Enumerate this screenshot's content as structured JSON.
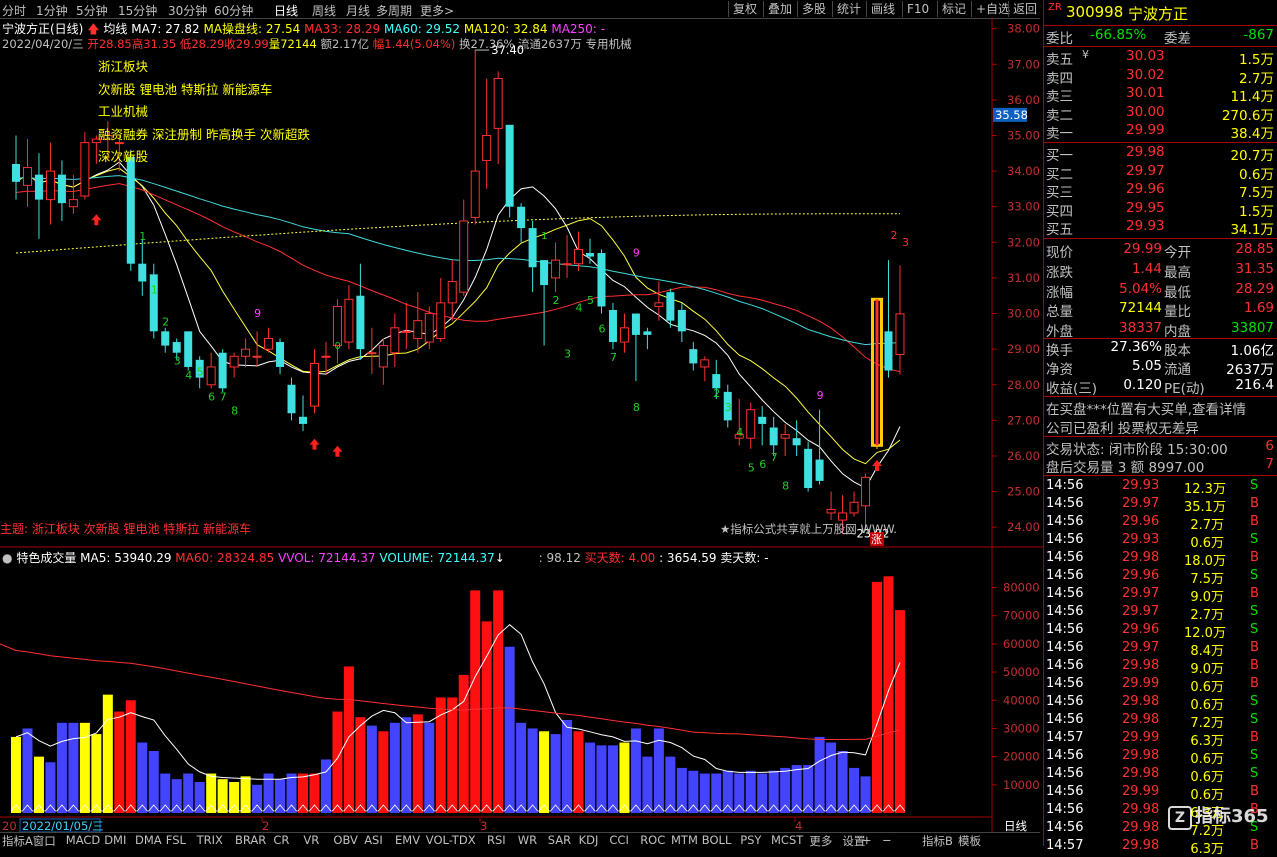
{
  "topbar": {
    "periods": [
      "分时",
      "1分钟",
      "5分钟",
      "15分钟",
      "30分钟",
      "60分钟",
      "日线",
      "周线",
      "月线",
      "多周期",
      "更多>"
    ],
    "active_period": "日线",
    "right_buttons": [
      "复权",
      "叠加",
      "多股",
      "统计",
      "画线",
      "F10",
      "标记",
      "+自选",
      "返回"
    ]
  },
  "ma_line": {
    "stock": "宁波方正(日线)",
    "indicator": "均线",
    "ma7": "MA7: 27.82",
    "ma_cp": "MA操盘线: 27.54",
    "ma33": "MA33: 28.29",
    "ma60": "MA60: 29.52",
    "ma120": "MA120: 32.84",
    "ma250": "MA250: -"
  },
  "bar_info": {
    "date": "2022/04/20/三",
    "open": "开28.85",
    "high": "高31.35",
    "low": "低28.29",
    "close": "收29.99",
    "vol": "量72144",
    "amount": "额2.17亿",
    "change": "幅1.44(5.04%)",
    "turnover": "换27.36%",
    "float": "流通2637万",
    "industry": "专用机械"
  },
  "tags": [
    "浙江板块",
    "次新股 锂电池 特斯拉 新能源车",
    "工业机械",
    "融资融券 深注册制 昨高换手 次新超跌",
    "深次新股"
  ],
  "bottom_tag": "主题: 浙江板块 次新股 锂电池 特斯拉 新能源车",
  "watermark": "★指标公式共享就上万股网 WWW.",
  "price_axis": [
    "38.00",
    "37.00",
    "36.00",
    "35.00",
    "34.00",
    "33.00",
    "32.00",
    "31.00",
    "30.00",
    "29.00",
    "28.00",
    "27.00",
    "26.00",
    "25.00",
    "24.00"
  ],
  "price_marker": "35.58",
  "high_mark": "37.40",
  "low_mark": "23.82",
  "zhang_label": "涨",
  "volume_panel": {
    "title": "特色成交量",
    "ma5": "MA5: 53940.29",
    "ma60": "MA60: 28324.85",
    "vvol": "VVOL: 72144.37",
    "volume": "VOLUME: 72144.37",
    "v1": ": 98.12",
    "buy_days": "买天数: 4.00",
    "v2": ": 3654.59",
    "sell_days": "卖天数: -",
    "axis": [
      "80000",
      "70000",
      "60000",
      "50000",
      "40000",
      "30000",
      "20000",
      "10000"
    ]
  },
  "date_axis": {
    "start": "2022/01/05/三",
    "marks": [
      "2",
      "3",
      "4"
    ],
    "period": "日线"
  },
  "bottom_tabs": [
    "指标A",
    "窗口",
    "MACD",
    "DMI",
    "DMA",
    "FSL",
    "TRIX",
    "BRAR",
    "CR",
    "VR",
    "OBV",
    "ASI",
    "EMV",
    "VOL-TDX",
    "RSI",
    "WR",
    "SAR",
    "KDJ",
    "CCI",
    "ROC",
    "MTM",
    "BOLL",
    "PSY",
    "MCST",
    "更多",
    "设置"
  ],
  "bottom_right_tabs": [
    "指标B",
    "模板"
  ],
  "side": {
    "zr": "ZR",
    "code": "300998",
    "name": "宁波方正",
    "weibi_label": "委比",
    "weibi": "-66.85%",
    "weicha_label": "委差",
    "weicha": "-867",
    "asks": [
      {
        "label": "卖五",
        "price": "30.03",
        "vol": "1.5万"
      },
      {
        "label": "卖四",
        "price": "30.02",
        "vol": "2.7万"
      },
      {
        "label": "卖三",
        "price": "30.01",
        "vol": "11.4万"
      },
      {
        "label": "卖二",
        "price": "30.00",
        "vol": "270.6万"
      },
      {
        "label": "卖一",
        "price": "29.99",
        "vol": "38.4万"
      }
    ],
    "yen": "¥",
    "bids": [
      {
        "label": "买一",
        "price": "29.98",
        "vol": "20.7万"
      },
      {
        "label": "买二",
        "price": "29.97",
        "vol": "0.6万"
      },
      {
        "label": "买三",
        "price": "29.96",
        "vol": "7.5万"
      },
      {
        "label": "买四",
        "price": "29.95",
        "vol": "1.5万"
      },
      {
        "label": "买五",
        "price": "29.93",
        "vol": "34.1万"
      }
    ],
    "stats": [
      {
        "l1": "现价",
        "v1": "29.99",
        "l2": "今开",
        "v2": "28.85"
      },
      {
        "l1": "涨跌",
        "v1": "1.44",
        "l2": "最高",
        "v2": "31.35"
      },
      {
        "l1": "涨幅",
        "v1": "5.04%",
        "l2": "最低",
        "v2": "28.29"
      },
      {
        "l1": "总量",
        "v1": "72144",
        "l2": "量比",
        "v2": "1.69"
      },
      {
        "l1": "外盘",
        "v1": "38337",
        "l2": "内盘",
        "v2": "33807"
      }
    ],
    "stats2": [
      {
        "l1": "换手",
        "v1": "27.36%",
        "l2": "股本",
        "v2": "1.06亿"
      },
      {
        "l1": "净资",
        "v1": "5.05",
        "l2": "流通",
        "v2": "2637万"
      },
      {
        "l1": "收益(三)",
        "v1": "0.120",
        "l2": "PE(动)",
        "v2": "216.4"
      }
    ],
    "notice1": "在买盘***位置有大买单,查看详情",
    "notice2": "公司已盈利 投票权无差异",
    "status_label": "交易状态: 闭市阶段 15:30:00",
    "status_num": "6",
    "after_label": "盘后交易量 3 额 8997.00",
    "after_num": "7",
    "trades": [
      {
        "t": "14:56",
        "p": "29.93",
        "v": "12.3万",
        "s": "S"
      },
      {
        "t": "14:56",
        "p": "29.97",
        "v": "35.1万",
        "s": "B"
      },
      {
        "t": "14:56",
        "p": "29.96",
        "v": "2.7万",
        "s": "B"
      },
      {
        "t": "14:56",
        "p": "29.93",
        "v": "0.6万",
        "s": "S"
      },
      {
        "t": "14:56",
        "p": "29.98",
        "v": "18.0万",
        "s": "B"
      },
      {
        "t": "14:56",
        "p": "29.96",
        "v": "7.5万",
        "s": "S"
      },
      {
        "t": "14:56",
        "p": "29.97",
        "v": "9.0万",
        "s": "B"
      },
      {
        "t": "14:56",
        "p": "29.97",
        "v": "2.7万",
        "s": "S"
      },
      {
        "t": "14:56",
        "p": "29.96",
        "v": "12.0万",
        "s": "S"
      },
      {
        "t": "14:56",
        "p": "29.97",
        "v": "8.4万",
        "s": "B"
      },
      {
        "t": "14:56",
        "p": "29.98",
        "v": "9.0万",
        "s": "B"
      },
      {
        "t": "14:56",
        "p": "29.99",
        "v": "0.6万",
        "s": "B"
      },
      {
        "t": "14:56",
        "p": "29.98",
        "v": "0.6万",
        "s": "S"
      },
      {
        "t": "14:56",
        "p": "29.98",
        "v": "7.2万",
        "s": "S"
      },
      {
        "t": "14:57",
        "p": "29.99",
        "v": "6.3万",
        "s": "B"
      },
      {
        "t": "14:56",
        "p": "29.98",
        "v": "0.6万",
        "s": "S"
      },
      {
        "t": "14:56",
        "p": "29.98",
        "v": "0.6万",
        "s": "S"
      },
      {
        "t": "14:56",
        "p": "29.99",
        "v": "0.6万",
        "s": "B"
      },
      {
        "t": "14:56",
        "p": "29.98",
        "v": "6.3万",
        "s": "B"
      },
      {
        "t": "14:56",
        "p": "29.98",
        "v": "7.2万",
        "s": "S"
      },
      {
        "t": "14:57",
        "p": "29.98",
        "v": "6.3万",
        "s": "B"
      }
    ],
    "logo": "指标365"
  },
  "chart_data": {
    "type": "candlestick",
    "candles": [
      {
        "o": 34.2,
        "c": 33.7,
        "h": 35.0,
        "l": 33.2
      },
      {
        "o": 33.6,
        "c": 34.1,
        "h": 34.9,
        "l": 33.0
      },
      {
        "o": 33.9,
        "c": 33.2,
        "h": 34.5,
        "l": 32.1
      },
      {
        "o": 33.2,
        "c": 34.0,
        "h": 34.8,
        "l": 32.5
      },
      {
        "o": 33.9,
        "c": 33.1,
        "h": 34.3,
        "l": 32.6
      },
      {
        "o": 33.0,
        "c": 33.2,
        "h": 33.9,
        "l": 32.8
      },
      {
        "o": 33.3,
        "c": 34.8,
        "h": 35.1,
        "l": 33.2
      },
      {
        "o": 34.8,
        "c": 34.9,
        "h": 35.0,
        "l": 34.2
      },
      {
        "o": 34.9,
        "c": 35.0,
        "h": 35.4,
        "l": 34.3
      },
      {
        "o": 34.8,
        "c": 34.8,
        "h": 35.0,
        "l": 34.0
      },
      {
        "o": 34.4,
        "c": 31.4,
        "h": 34.6,
        "l": 31.2
      },
      {
        "o": 31.4,
        "c": 30.9,
        "h": 32.1,
        "l": 30.5
      },
      {
        "o": 31.1,
        "c": 29.5,
        "h": 31.4,
        "l": 29.3
      },
      {
        "o": 29.5,
        "c": 29.1,
        "h": 29.6,
        "l": 28.9
      },
      {
        "o": 29.2,
        "c": 28.9,
        "h": 29.3,
        "l": 28.7
      },
      {
        "o": 29.5,
        "c": 28.5,
        "h": 29.5,
        "l": 28.4
      },
      {
        "o": 28.7,
        "c": 28.2,
        "h": 28.8,
        "l": 27.9
      },
      {
        "o": 28.0,
        "c": 28.5,
        "h": 28.9,
        "l": 27.9
      },
      {
        "o": 28.9,
        "c": 27.9,
        "h": 29.0,
        "l": 27.8
      },
      {
        "o": 28.5,
        "c": 28.8,
        "h": 28.9,
        "l": 28.2
      },
      {
        "o": 28.8,
        "c": 29.0,
        "h": 29.3,
        "l": 28.5
      },
      {
        "o": 28.8,
        "c": 28.8,
        "h": 29.5,
        "l": 28.5
      },
      {
        "o": 29.0,
        "c": 29.3,
        "h": 29.6,
        "l": 28.9
      },
      {
        "o": 29.2,
        "c": 28.5,
        "h": 29.3,
        "l": 28.3
      },
      {
        "o": 28.0,
        "c": 27.2,
        "h": 28.2,
        "l": 27.0
      },
      {
        "o": 27.1,
        "c": 26.9,
        "h": 27.7,
        "l": 26.7
      },
      {
        "o": 27.4,
        "c": 28.6,
        "h": 29.0,
        "l": 27.2
      },
      {
        "o": 28.8,
        "c": 28.8,
        "h": 29.2,
        "l": 28.3
      },
      {
        "o": 29.1,
        "c": 30.2,
        "h": 30.4,
        "l": 28.6
      },
      {
        "o": 29.2,
        "c": 30.4,
        "h": 30.8,
        "l": 29.0
      },
      {
        "o": 30.5,
        "c": 29.0,
        "h": 31.4,
        "l": 28.7
      },
      {
        "o": 28.9,
        "c": 28.9,
        "h": 29.6,
        "l": 28.3
      },
      {
        "o": 28.5,
        "c": 29.1,
        "h": 29.3,
        "l": 28.0
      },
      {
        "o": 28.9,
        "c": 29.6,
        "h": 30.0,
        "l": 28.5
      },
      {
        "o": 29.5,
        "c": 29.5,
        "h": 30.3,
        "l": 29.0
      },
      {
        "o": 29.3,
        "c": 29.8,
        "h": 30.6,
        "l": 28.9
      },
      {
        "o": 29.2,
        "c": 30.0,
        "h": 30.2,
        "l": 29.0
      },
      {
        "o": 29.3,
        "c": 30.3,
        "h": 31.0,
        "l": 29.2
      },
      {
        "o": 30.3,
        "c": 30.9,
        "h": 31.5,
        "l": 29.8
      },
      {
        "o": 30.6,
        "c": 32.6,
        "h": 33.2,
        "l": 30.5
      },
      {
        "o": 32.7,
        "c": 34.0,
        "h": 37.4,
        "l": 32.5
      },
      {
        "o": 34.3,
        "c": 35.0,
        "h": 36.6,
        "l": 33.5
      },
      {
        "o": 35.2,
        "c": 36.6,
        "h": 36.8,
        "l": 34.2
      },
      {
        "o": 35.3,
        "c": 33.0,
        "h": 35.3,
        "l": 32.7
      },
      {
        "o": 33.0,
        "c": 32.4,
        "h": 33.1,
        "l": 32.0
      },
      {
        "o": 32.4,
        "c": 31.3,
        "h": 32.6,
        "l": 30.6
      },
      {
        "o": 31.5,
        "c": 30.8,
        "h": 31.5,
        "l": 29.1
      },
      {
        "o": 31.0,
        "c": 31.5,
        "h": 32.0,
        "l": 30.6
      },
      {
        "o": 31.4,
        "c": 31.4,
        "h": 32.2,
        "l": 31.0
      },
      {
        "o": 31.4,
        "c": 31.8,
        "h": 32.3,
        "l": 31.2
      },
      {
        "o": 31.7,
        "c": 31.6,
        "h": 32.1,
        "l": 31.4
      },
      {
        "o": 31.7,
        "c": 30.2,
        "h": 31.8,
        "l": 30.0
      },
      {
        "o": 30.1,
        "c": 29.2,
        "h": 30.3,
        "l": 29.0
      },
      {
        "o": 29.2,
        "c": 29.6,
        "h": 30.0,
        "l": 28.9
      },
      {
        "o": 30.0,
        "c": 29.4,
        "h": 30.0,
        "l": 28.1
      },
      {
        "o": 29.5,
        "c": 29.4,
        "h": 29.6,
        "l": 29.0
      },
      {
        "o": 30.2,
        "c": 30.3,
        "h": 30.9,
        "l": 29.8
      },
      {
        "o": 30.6,
        "c": 29.8,
        "h": 30.7,
        "l": 29.6
      },
      {
        "o": 30.1,
        "c": 29.5,
        "h": 30.3,
        "l": 29.2
      },
      {
        "o": 29.0,
        "c": 28.6,
        "h": 29.2,
        "l": 28.4
      },
      {
        "o": 28.5,
        "c": 28.7,
        "h": 28.8,
        "l": 28.1
      },
      {
        "o": 28.3,
        "c": 27.9,
        "h": 28.7,
        "l": 27.6
      },
      {
        "o": 27.8,
        "c": 27.0,
        "h": 28.0,
        "l": 26.8
      },
      {
        "o": 26.5,
        "c": 26.6,
        "h": 27.6,
        "l": 26.3
      },
      {
        "o": 26.5,
        "c": 27.3,
        "h": 27.5,
        "l": 26.2
      },
      {
        "o": 27.1,
        "c": 26.9,
        "h": 27.4,
        "l": 26.3
      },
      {
        "o": 26.8,
        "c": 26.3,
        "h": 27.1,
        "l": 26.0
      },
      {
        "o": 26.5,
        "c": 26.6,
        "h": 26.9,
        "l": 26.0
      },
      {
        "o": 26.5,
        "c": 26.3,
        "h": 27.0,
        "l": 26.0
      },
      {
        "o": 26.2,
        "c": 25.1,
        "h": 26.4,
        "l": 25.0
      },
      {
        "o": 25.9,
        "c": 25.3,
        "h": 27.3,
        "l": 25.2
      },
      {
        "o": 24.4,
        "c": 24.5,
        "h": 25.0,
        "l": 24.2
      },
      {
        "o": 24.2,
        "c": 24.4,
        "h": 24.9,
        "l": 23.82
      },
      {
        "o": 24.4,
        "c": 24.7,
        "h": 25.0,
        "l": 24.3
      },
      {
        "o": 24.6,
        "c": 25.4,
        "h": 25.5,
        "l": 23.9
      },
      {
        "o": 26.3,
        "c": 30.4,
        "h": 30.4,
        "l": 26.2
      },
      {
        "o": 29.5,
        "c": 28.4,
        "h": 31.5,
        "l": 28.2
      },
      {
        "o": 28.85,
        "c": 29.99,
        "h": 31.35,
        "l": 28.29
      }
    ],
    "volume": [
      27000,
      30000,
      20000,
      18000,
      32000,
      32000,
      32000,
      28000,
      42000,
      36000,
      40000,
      25000,
      22000,
      14000,
      12000,
      14000,
      11000,
      14000,
      12000,
      11000,
      13000,
      10000,
      14000,
      12000,
      14000,
      14000,
      14000,
      19000,
      36000,
      52000,
      34000,
      31000,
      29000,
      32000,
      34000,
      35000,
      32000,
      41000,
      41000,
      49000,
      79000,
      68000,
      79000,
      59000,
      32000,
      30000,
      29000,
      28000,
      33000,
      29000,
      25000,
      24000,
      24000,
      25000,
      30000,
      20000,
      30000,
      20000,
      16000,
      15000,
      14000,
      14000,
      15000,
      14000,
      15000,
      14000,
      15000,
      16000,
      17000,
      17000,
      27000,
      25000,
      22000,
      16000,
      13000,
      82000,
      84000,
      72000
    ],
    "vol_types": [
      "y",
      "b",
      "y",
      "b",
      "b",
      "b",
      "y",
      "y",
      "y",
      "r",
      "r",
      "b",
      "b",
      "b",
      "b",
      "b",
      "b",
      "y",
      "y",
      "y",
      "y",
      "b",
      "b",
      "b",
      "b",
      "r",
      "r",
      "b",
      "r",
      "r",
      "r",
      "b",
      "r",
      "b",
      "b",
      "r",
      "b",
      "r",
      "r",
      "r",
      "r",
      "r",
      "r",
      "b",
      "b",
      "b",
      "y",
      "b",
      "b",
      "r",
      "b",
      "b",
      "b",
      "y",
      "b",
      "b",
      "b",
      "b",
      "b",
      "b",
      "b",
      "b",
      "b",
      "b",
      "b",
      "b",
      "b",
      "b",
      "b",
      "b",
      "b",
      "b",
      "b",
      "b",
      "b",
      "r",
      "r",
      "r"
    ],
    "ylim": [
      23.5,
      38.3
    ],
    "vol_ylim": [
      0,
      88000
    ]
  }
}
